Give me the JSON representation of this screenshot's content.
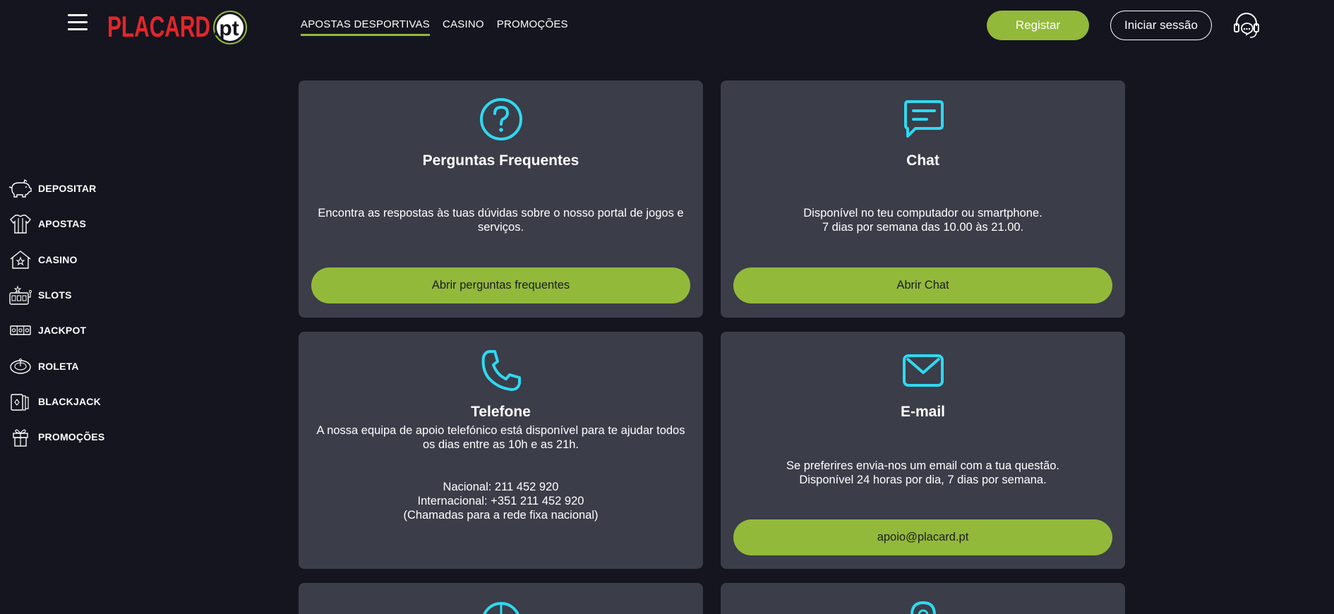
{
  "header": {
    "logo_text": "PLACARD",
    "logo_suffix": ".pt",
    "nav": [
      {
        "label": "APOSTAS DESPORTIVAS",
        "active": true
      },
      {
        "label": "CASINO",
        "active": false
      },
      {
        "label": "PROMOÇÕES",
        "active": false
      }
    ],
    "register_label": "Registar",
    "login_label": "Iniciar sessão"
  },
  "sidebar": {
    "items": [
      {
        "label": "DEPOSITAR",
        "icon": "piggy-bank-icon"
      },
      {
        "label": "APOSTAS",
        "icon": "jersey-icon"
      },
      {
        "label": "CASINO",
        "icon": "casino-house-icon"
      },
      {
        "label": "SLOTS",
        "icon": "slot-machine-icon"
      },
      {
        "label": "JACKPOT",
        "icon": "jackpot-icon"
      },
      {
        "label": "ROLETA",
        "icon": "roulette-icon"
      },
      {
        "label": "BLACKJACK",
        "icon": "cards-icon"
      },
      {
        "label": "PROMOÇÕES",
        "icon": "gift-icon"
      }
    ]
  },
  "cards": {
    "faq": {
      "title": "Perguntas Frequentes",
      "description": "Encontra as respostas às tuas dúvidas sobre o nosso portal de jogos e serviços.",
      "button_label": "Abrir perguntas frequentes"
    },
    "chat": {
      "title": "Chat",
      "description_line1": "Disponível no teu computador ou smartphone.",
      "description_line2": "7 dias por semana das 10.00 às 21.00.",
      "button_label": "Abrir Chat"
    },
    "phone": {
      "title": "Telefone",
      "description": "A nossa equipa de apoio telefónico está disponível para te ajudar todos os dias entre as 10h e as 21h.",
      "national": "Nacional: 211 452 920",
      "international": "Internacional: +351 211 452 920",
      "note": "(Chamadas para a rede fixa nacional)"
    },
    "email": {
      "title": "E-mail",
      "description_line1": "Se preferires envia-nos um email com a tua questão.",
      "description_line2": "Disponível 24 horas por dia, 7 dias por semana.",
      "button_label": "apoio@placard.pt"
    }
  },
  "colors": {
    "background": "#14151f",
    "card": "#3b3d49",
    "accent_green": "#93b93a",
    "icon_cyan": "#2fd9f0",
    "logo_red": "#e3262b"
  }
}
